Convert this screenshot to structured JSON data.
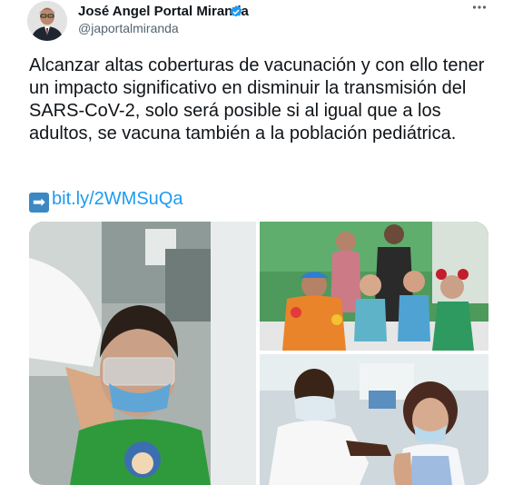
{
  "author": {
    "name": "José Angel Portal Miranda",
    "handle": "@japortalmiranda",
    "verified": true,
    "avatar_icon": "profile-photo"
  },
  "more_icon": "more-options-icon",
  "tweet": {
    "text": "Alcanzar altas coberturas de vacunación y con ello tener un impacto significativo en disminuir la transmisión del SARS-CoV-2, solo será posible si al igual que a los adultos, se vacuna también a la población pediátrica.",
    "link_icon": "right-arrow-emoji",
    "link": "bit.ly/2WMSuQa"
  },
  "media": [
    {
      "icon": "photo-child-with-face-shield-vaccination"
    },
    {
      "icon": "photo-children-with-clowns-group"
    },
    {
      "icon": "photo-nurse-vaccinating-girl"
    }
  ],
  "colors": {
    "link": "#1d9bf0",
    "verified": "#1d9bf0",
    "secondary_text": "#536471"
  }
}
